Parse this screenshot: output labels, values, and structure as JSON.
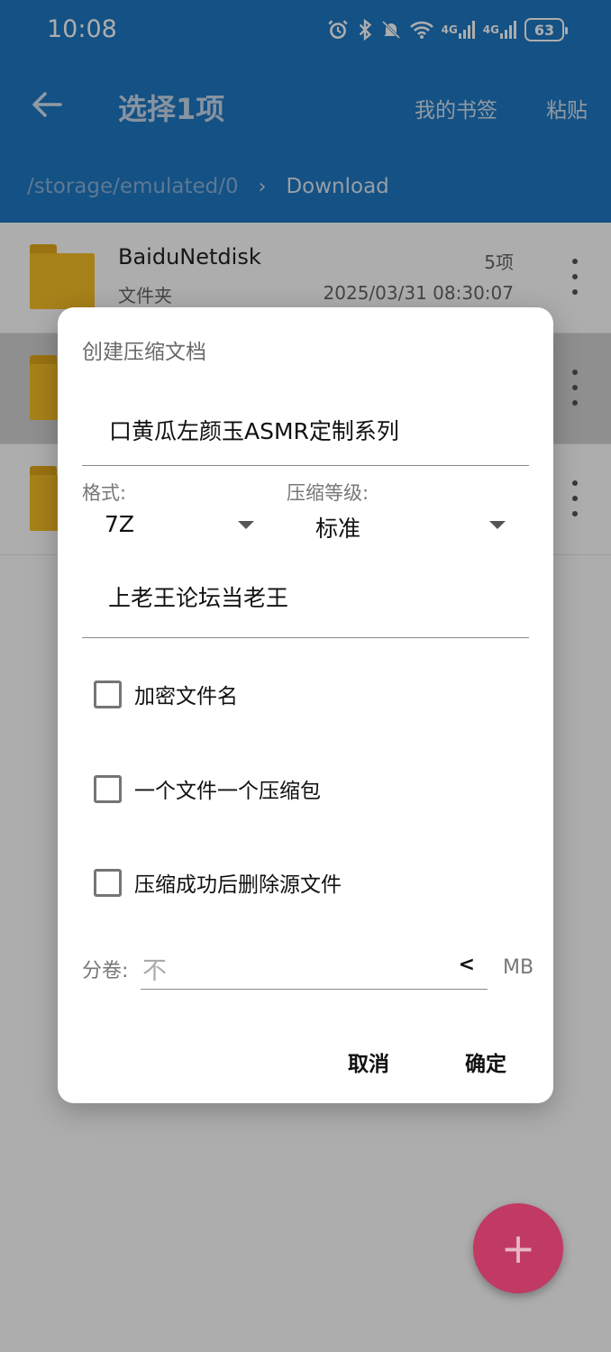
{
  "status_bar": {
    "time": "10:08",
    "battery": "63",
    "net1": "4G",
    "net2": "4G"
  },
  "appbar": {
    "title": "选择1项",
    "bookmark_label": "我的书签",
    "paste_label": "粘贴"
  },
  "breadcrumb": {
    "root": "/storage/emulated/0",
    "current": "Download"
  },
  "list": {
    "rows": [
      {
        "name": "BaiduNetdisk",
        "sub": "文件夹",
        "count": "5项",
        "date": "2025/03/31 08:30:07"
      }
    ]
  },
  "dialog": {
    "title": "创建压缩文档",
    "archive_name": "口黄瓜左颜玉ASMR定制系列",
    "format_label": "格式:",
    "format_value": "7Z",
    "level_label": "压缩等级:",
    "level_value": "标准",
    "password": "上老王论坛当老王",
    "cb_encrypt": "加密文件名",
    "cb_one_per_file": "一个文件一个压缩包",
    "cb_delete_source": "压缩成功后删除源文件",
    "volume_label": "分卷:",
    "volume_placeholder": "不",
    "volume_unit": "MB",
    "cancel": "取消",
    "ok": "确定"
  },
  "colors": {
    "appbar": "#1E78C3",
    "fab": "#C13A63",
    "folder": "#F6BF25"
  }
}
